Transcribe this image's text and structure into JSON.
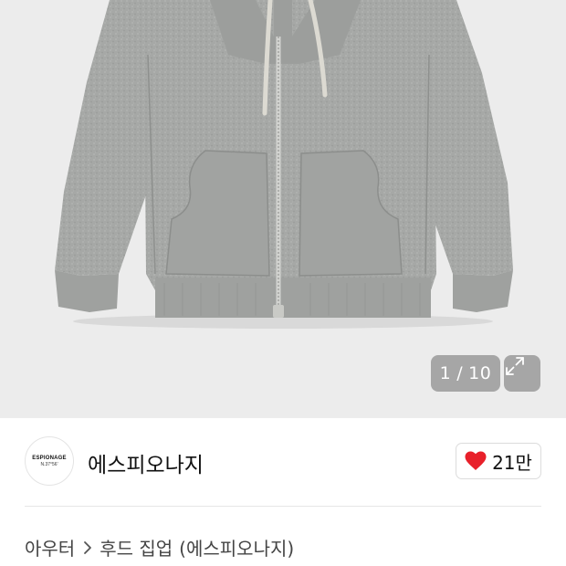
{
  "gallery": {
    "current": "1",
    "total": "10",
    "separator": "/",
    "expand_icon": "expand-diagonal-icon",
    "colors": {
      "background": "#ececec",
      "hoodie": "#a6a8a6",
      "drawstring": "#dcdad2"
    }
  },
  "brand": {
    "logo_text": "ESPIONAGE",
    "logo_subtext": "N.37°56'",
    "name": "에스피오나지",
    "likes": "21만",
    "like_icon": "heart-icon",
    "like_color": "#e8202a"
  },
  "breadcrumb": {
    "category": "아우터",
    "separator_icon": "chevron-right-icon",
    "subcategory": "후드 집업",
    "brand_suffix": "(에스피오나지)"
  }
}
